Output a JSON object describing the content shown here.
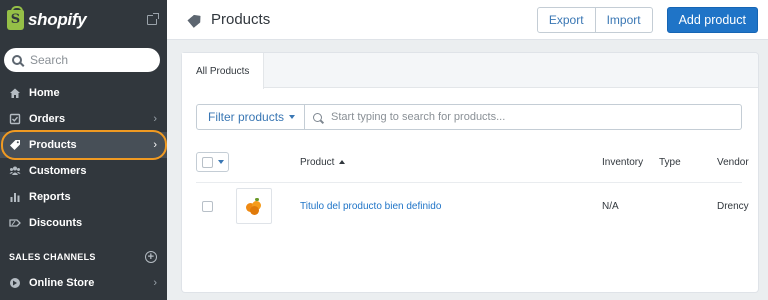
{
  "brand": {
    "name": "shopify",
    "logo_glyph": "S"
  },
  "sidebar": {
    "search_placeholder": "Search",
    "items": [
      {
        "label": "Home",
        "icon": "home-icon",
        "chevron": false
      },
      {
        "label": "Orders",
        "icon": "orders-icon",
        "chevron": true
      },
      {
        "label": "Products",
        "icon": "tag-icon",
        "chevron": true,
        "active": true
      },
      {
        "label": "Customers",
        "icon": "customers-icon",
        "chevron": false
      },
      {
        "label": "Reports",
        "icon": "reports-icon",
        "chevron": false
      },
      {
        "label": "Discounts",
        "icon": "discounts-icon",
        "chevron": false
      }
    ],
    "sales_channels_header": "SALES CHANNELS",
    "channels": [
      {
        "label": "Online Store",
        "icon": "online-store-icon",
        "chevron": true
      }
    ],
    "chevron_glyph": "›",
    "plus_glyph": "+"
  },
  "header": {
    "title": "Products",
    "export_label": "Export",
    "import_label": "Import",
    "add_product_label": "Add product"
  },
  "card": {
    "tab_label": "All Products",
    "filter_label": "Filter products",
    "search_placeholder": "Start typing to search for products...",
    "columns": {
      "product": "Product",
      "inventory": "Inventory",
      "type": "Type",
      "vendor": "Vendor"
    },
    "rows": [
      {
        "title": "Titulo del producto bien definido",
        "inventory": "N/A",
        "type": "",
        "vendor": "Drency"
      }
    ]
  },
  "colors": {
    "sidebar_bg": "#31373d",
    "accent_blue": "#1f74c7",
    "highlight_ring": "#f09a22",
    "logo_green": "#95bf47"
  }
}
